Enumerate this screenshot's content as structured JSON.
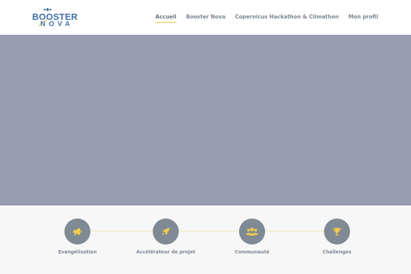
{
  "logo": {
    "line1": "BOOSTER",
    "line2": "NOVA",
    "colors": {
      "text": "#3d6fa8",
      "accent": "#e8c547"
    }
  },
  "nav": {
    "items": [
      {
        "label": "Accueil",
        "active": true
      },
      {
        "label": "Booster Nova",
        "active": false
      },
      {
        "label": "Copernicus Hackathon & Climathon",
        "active": false
      },
      {
        "label": "Mon profil",
        "active": false
      }
    ],
    "active_underline_color": "#e8c547"
  },
  "hero": {
    "background": "#989cb0"
  },
  "features": [
    {
      "label": "Evangélisation",
      "icon": "megaphone-icon"
    },
    {
      "label": "Accélérateur de projet",
      "icon": "rocket-icon"
    },
    {
      "label": "Communauté",
      "icon": "community-icon"
    },
    {
      "label": "Challenges",
      "icon": "trophy-icon"
    }
  ],
  "colors": {
    "icon_circle": "#7f8a94",
    "icon_glyph": "#f1cc4d",
    "connector": "#f0e6b8"
  }
}
